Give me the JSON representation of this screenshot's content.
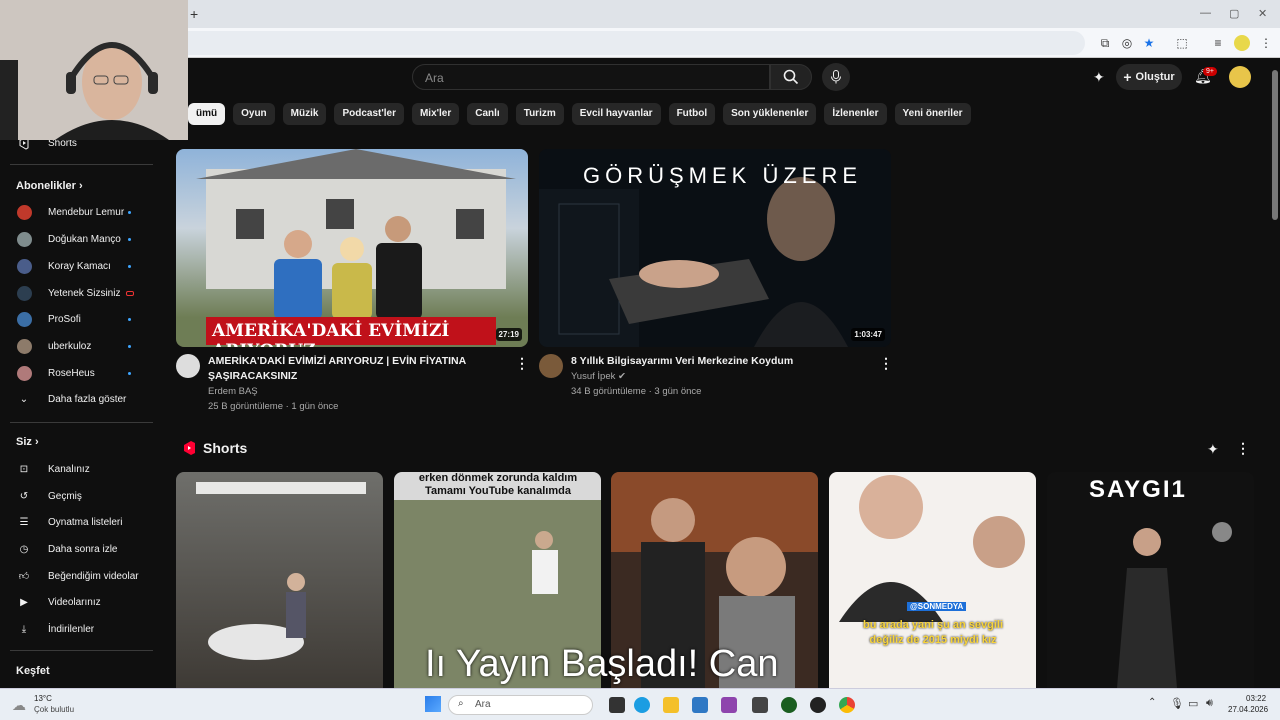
{
  "browser": {
    "new_tab": "+",
    "minimize": "—",
    "restore": "▢",
    "close": "✕"
  },
  "header": {
    "search_placeholder": "Ara",
    "create_label": "Oluştur",
    "notif_badge": "9+"
  },
  "chips": [
    "ümü",
    "Oyun",
    "Müzik",
    "Podcast'ler",
    "Mix'ler",
    "Canlı",
    "Turizm",
    "Evcil hayvanlar",
    "Futbol",
    "Son yüklenenler",
    "İzlenenler",
    "Yeni öneriler"
  ],
  "sidebar": {
    "shorts": "Shorts",
    "subs_head": "Abonelikler",
    "subs": [
      {
        "name": "Mendebur Lemur",
        "color": "#c0392b"
      },
      {
        "name": "Doğukan Manço",
        "color": "#7f8c8d"
      },
      {
        "name": "Koray Kamacı",
        "color": "#4a5d8a"
      },
      {
        "name": "Yetenek Sizsiniz",
        "color": "#2c3e50"
      },
      {
        "name": "ProSofi",
        "color": "#3b6ea5"
      },
      {
        "name": "uberkuloz",
        "color": "#8d7b6a"
      },
      {
        "name": "RoseHeus",
        "color": "#b07a7a"
      }
    ],
    "more": "Daha fazla göster",
    "you_head": "Siz",
    "you": [
      "Kanalınız",
      "Geçmiş",
      "Oynatma listeleri",
      "Daha sonra izle",
      "Beğendiğim videolar",
      "Videolarınız",
      "İndirilenler"
    ],
    "explore": "Keşfet"
  },
  "videos": [
    {
      "title_line1": "AMERİKA'DAKİ EVİMİZİ ARIYORUZ | EVİN FİYATINA",
      "title_line2": "ŞAŞIRACAKSINIZ",
      "channel": "Erdem BAŞ",
      "meta": "25 B görüntüleme · 1 gün önce",
      "duration": "27:19",
      "thumb_caption": "AMERİKA'DAKİ EVİMİZİ ARIYORUZ"
    },
    {
      "title_line1": "8 Yıllık Bilgisayarımı Veri Merkezine Koydum",
      "title_line2": "",
      "channel": "Yusuf İpek",
      "meta": "34 B görüntüleme · 3 gün önce",
      "duration": "1:03:47",
      "thumb_caption": "GÖRÜŞMEK ÜZERE"
    }
  ],
  "shorts": {
    "heading": "Shorts",
    "items": [
      {
        "caption": ""
      },
      {
        "caption": "erken dönmek zorunda kaldım Tamamı YouTube kanalımda"
      },
      {
        "caption": ""
      },
      {
        "caption": "bu arada yani şu an sevgili değiliz de 2015 miydi kız",
        "handle": "@SONMEDYA"
      },
      {
        "caption": "SAYGI1"
      }
    ]
  },
  "overlay": "Iı Yayın Başladı! Can",
  "taskbar": {
    "temp": "13°C",
    "weather": "Çok bulutlu",
    "search": "Ara",
    "time": "03:22",
    "date": "27.04.2026"
  },
  "colors": {
    "accent": "#3ea6ff",
    "brand_red": "#ff0033",
    "background": "#0f0f0f"
  }
}
